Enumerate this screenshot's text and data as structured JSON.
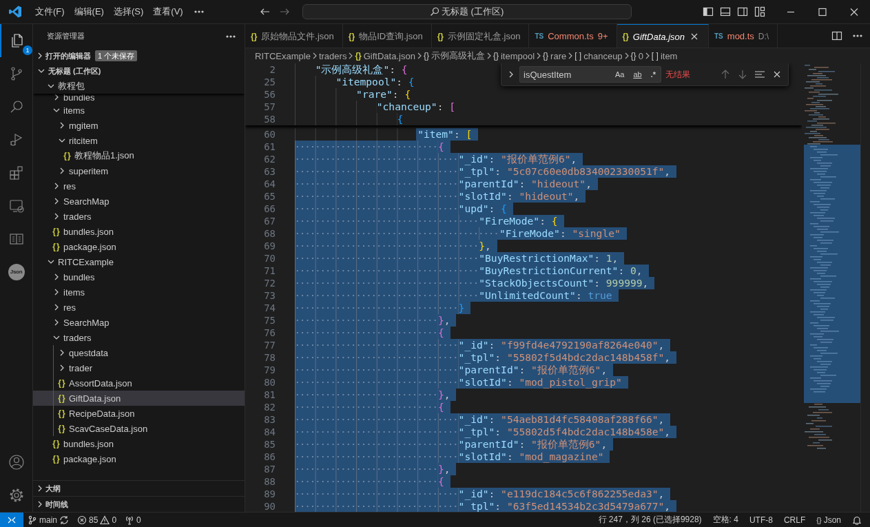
{
  "title_bar": {
    "menus": [
      {
        "label": "文件(F)"
      },
      {
        "label": "编辑(E)"
      },
      {
        "label": "选择(S)"
      },
      {
        "label": "查看(V)"
      }
    ],
    "command_center": "无标题 (工作区)"
  },
  "activity_bar": {
    "top": [
      {
        "kind": "explorer",
        "selected": true,
        "badge": "1"
      },
      {
        "kind": "scm",
        "selected": false
      },
      {
        "kind": "search",
        "selected": false
      },
      {
        "kind": "debug",
        "selected": false
      },
      {
        "kind": "extensions",
        "selected": false
      },
      {
        "kind": "remote",
        "selected": false
      },
      {
        "kind": "book",
        "selected": false
      },
      {
        "kind": "json",
        "selected": false,
        "label": "Json"
      }
    ],
    "bottom": [
      {
        "kind": "account",
        "selected": false
      },
      {
        "kind": "settings",
        "selected": false
      }
    ]
  },
  "sidebar": {
    "title": "资源管理器",
    "open_editors": {
      "label": "打开的编辑器",
      "expanded": false,
      "badge": "1 个未保存"
    },
    "tree": {
      "kind": "root",
      "label": "无标题 (工作区)",
      "expanded": true,
      "selected": false,
      "children": [
        {
          "kind": "folder",
          "label": "教程包",
          "expanded": true,
          "selected": false,
          "children": [
            {
              "kind": "folder",
              "label": "bundles",
              "expanded": false,
              "selected": false
            },
            {
              "kind": "folder",
              "label": "items",
              "expanded": true,
              "selected": false,
              "children": [
                {
                  "kind": "folder",
                  "label": "mgitem",
                  "expanded": false,
                  "selected": false
                },
                {
                  "kind": "folder",
                  "label": "ritcitem",
                  "expanded": true,
                  "selected": false,
                  "children": [
                    {
                      "kind": "file",
                      "icon": "{}",
                      "label": "教程物品1.json",
                      "selected": false
                    }
                  ]
                },
                {
                  "kind": "folder",
                  "label": "superitem",
                  "expanded": false,
                  "selected": false
                }
              ]
            },
            {
              "kind": "folder",
              "label": "res",
              "expanded": false,
              "selected": false
            },
            {
              "kind": "folder",
              "label": "SearchMap",
              "expanded": false,
              "selected": false
            },
            {
              "kind": "folder",
              "label": "traders",
              "expanded": false,
              "selected": false
            },
            {
              "kind": "file",
              "icon": "{}",
              "label": "bundles.json",
              "selected": false
            },
            {
              "kind": "file",
              "icon": "{}",
              "label": "package.json",
              "selected": false
            }
          ]
        },
        {
          "kind": "folder",
          "label": "RITCExample",
          "expanded": true,
          "selected": false,
          "children": [
            {
              "kind": "folder",
              "label": "bundles",
              "expanded": false,
              "selected": false
            },
            {
              "kind": "folder",
              "label": "items",
              "expanded": false,
              "selected": false
            },
            {
              "kind": "folder",
              "label": "res",
              "expanded": false,
              "selected": false
            },
            {
              "kind": "folder",
              "label": "SearchMap",
              "expanded": false,
              "selected": false
            },
            {
              "kind": "folder",
              "label": "traders",
              "expanded": true,
              "selected": false,
              "children": [
                {
                  "kind": "folder",
                  "label": "questdata",
                  "expanded": false,
                  "selected": false
                },
                {
                  "kind": "folder",
                  "label": "trader",
                  "expanded": false,
                  "selected": false
                },
                {
                  "kind": "file",
                  "icon": "{}",
                  "label": "AssortData.json",
                  "selected": false
                },
                {
                  "kind": "file",
                  "icon": "{}",
                  "label": "GiftData.json",
                  "selected": true
                },
                {
                  "kind": "file",
                  "icon": "{}",
                  "label": "RecipeData.json",
                  "selected": false
                },
                {
                  "kind": "file",
                  "icon": "{}",
                  "label": "ScavCaseData.json",
                  "selected": false
                }
              ]
            },
            {
              "kind": "file",
              "icon": "{}",
              "label": "bundles.json",
              "selected": false
            },
            {
              "kind": "file",
              "icon": "{}",
              "label": "package.json",
              "selected": false
            }
          ]
        }
      ]
    },
    "sections": [
      {
        "label": "大纲",
        "expanded": false
      },
      {
        "label": "时间线",
        "expanded": false
      }
    ]
  },
  "tabs": [
    {
      "kind": "json",
      "icon": "{}",
      "label": "原始物品文件.json",
      "selected": false,
      "preview": false,
      "problem": false
    },
    {
      "kind": "json",
      "icon": "{}",
      "label": "物品ID查询.json",
      "selected": false,
      "preview": false,
      "problem": false
    },
    {
      "kind": "json",
      "icon": "{}",
      "label": "示例固定礼盒.json",
      "selected": false,
      "preview": false,
      "problem": false
    },
    {
      "kind": "ts",
      "icon": "TS",
      "label": "Common.ts",
      "badge": "9+",
      "selected": false,
      "preview": false,
      "problem": true
    },
    {
      "kind": "json",
      "icon": "{}",
      "label": "GiftData.json",
      "selected": true,
      "preview": true,
      "problem": false
    },
    {
      "kind": "ts",
      "icon": "TS",
      "label": "mod.ts",
      "description": "D:\\",
      "selected": false,
      "preview": false,
      "problem": true
    }
  ],
  "breadcrumbs": [
    {
      "kind": "folder",
      "label": "RITCExample"
    },
    {
      "kind": "folder",
      "label": "traders"
    },
    {
      "kind": "file",
      "icon": "{}",
      "label": "GiftData.json"
    },
    {
      "kind": "symbol",
      "icon": "{}",
      "label": "示例高级礼盒"
    },
    {
      "kind": "symbol",
      "icon": "{}",
      "label": "itempool"
    },
    {
      "kind": "symbol",
      "icon": "{}",
      "label": "rare"
    },
    {
      "kind": "symbol",
      "icon": "[ ]",
      "label": "chanceup"
    },
    {
      "kind": "symbol",
      "icon": "{}",
      "label": "0"
    },
    {
      "kind": "symbol",
      "icon": "[ ]",
      "label": "item"
    }
  ],
  "find": {
    "value": "isQuestItem",
    "options": [
      {
        "kind": "case",
        "label": "Aa",
        "on": false
      },
      {
        "kind": "word",
        "label": "ab",
        "on": false
      },
      {
        "kind": "regex",
        "label": ".*",
        "on": false
      }
    ],
    "result": "无结果"
  },
  "sticky_lines": [
    {
      "num": "2",
      "tokens": [
        {
          "kind": "key",
          "text": "\"示例高级礼盒\""
        },
        {
          "kind": "punc",
          "text": ": "
        },
        {
          "kind": "bracket",
          "text": "{",
          "color": "#da70d6"
        }
      ]
    },
    {
      "num": "25",
      "tokens": [
        {
          "kind": "key",
          "text": "\"itempool\""
        },
        {
          "kind": "punc",
          "text": ": "
        },
        {
          "kind": "bracket",
          "text": "{",
          "color": "#179fff"
        }
      ]
    },
    {
      "num": "56",
      "tokens": [
        {
          "kind": "key",
          "text": "\"rare\""
        },
        {
          "kind": "punc",
          "text": ": "
        },
        {
          "kind": "bracket",
          "text": "{",
          "color": "#ffd700"
        }
      ]
    },
    {
      "num": "57",
      "tokens": [
        {
          "kind": "key",
          "text": "\"chanceup\""
        },
        {
          "kind": "punc",
          "text": ": "
        },
        {
          "kind": "bracket",
          "text": "[",
          "color": "#da70d6"
        }
      ]
    },
    {
      "num": "58",
      "tokens": [
        {
          "kind": "bracket",
          "text": "{",
          "color": "#179fff"
        }
      ]
    }
  ],
  "lines": [
    {
      "num": "60",
      "selected": true,
      "indent_selected": false,
      "tokens": [
        {
          "kind": "key",
          "text": "\"item\""
        },
        {
          "kind": "punc",
          "text": ": "
        },
        {
          "kind": "bracket",
          "text": "[",
          "color": "#ffd700"
        }
      ]
    },
    {
      "num": "61",
      "selected": true,
      "indent_selected": true,
      "tokens": [
        {
          "kind": "bracket",
          "text": "{",
          "color": "#da70d6"
        }
      ]
    },
    {
      "num": "62",
      "selected": true,
      "indent_selected": true,
      "tokens": [
        {
          "kind": "key",
          "text": "\"_id\""
        },
        {
          "kind": "punc",
          "text": ": "
        },
        {
          "kind": "str",
          "text": "\"报价单范例6\""
        },
        {
          "kind": "punc",
          "text": ","
        }
      ]
    },
    {
      "num": "63",
      "selected": true,
      "indent_selected": true,
      "tokens": [
        {
          "kind": "key",
          "text": "\"_tpl\""
        },
        {
          "kind": "punc",
          "text": ": "
        },
        {
          "kind": "str",
          "text": "\"5c07c60e0db834002330051f\""
        },
        {
          "kind": "punc",
          "text": ","
        }
      ]
    },
    {
      "num": "64",
      "selected": true,
      "indent_selected": true,
      "tokens": [
        {
          "kind": "key",
          "text": "\"parentId\""
        },
        {
          "kind": "punc",
          "text": ": "
        },
        {
          "kind": "str",
          "text": "\"hideout\""
        },
        {
          "kind": "punc",
          "text": ","
        }
      ]
    },
    {
      "num": "65",
      "selected": true,
      "indent_selected": true,
      "tokens": [
        {
          "kind": "key",
          "text": "\"slotId\""
        },
        {
          "kind": "punc",
          "text": ": "
        },
        {
          "kind": "str",
          "text": "\"hideout\""
        },
        {
          "kind": "punc",
          "text": ","
        }
      ]
    },
    {
      "num": "66",
      "selected": true,
      "indent_selected": true,
      "tokens": [
        {
          "kind": "key",
          "text": "\"upd\""
        },
        {
          "kind": "punc",
          "text": ": "
        },
        {
          "kind": "bracket",
          "text": "{",
          "color": "#179fff"
        }
      ]
    },
    {
      "num": "67",
      "selected": true,
      "indent_selected": true,
      "tokens": [
        {
          "kind": "key",
          "text": "\"FireMode\""
        },
        {
          "kind": "punc",
          "text": ": "
        },
        {
          "kind": "bracket",
          "text": "{",
          "color": "#ffd700"
        }
      ]
    },
    {
      "num": "68",
      "selected": true,
      "indent_selected": true,
      "tokens": [
        {
          "kind": "key",
          "text": "\"FireMode\""
        },
        {
          "kind": "punc",
          "text": ": "
        },
        {
          "kind": "str",
          "text": "\"single\""
        }
      ]
    },
    {
      "num": "69",
      "selected": true,
      "indent_selected": true,
      "tokens": [
        {
          "kind": "bracket",
          "text": "}",
          "color": "#ffd700"
        },
        {
          "kind": "punc",
          "text": ","
        }
      ]
    },
    {
      "num": "70",
      "selected": true,
      "indent_selected": true,
      "tokens": [
        {
          "kind": "key",
          "text": "\"BuyRestrictionMax\""
        },
        {
          "kind": "punc",
          "text": ": "
        },
        {
          "kind": "num",
          "text": "1"
        },
        {
          "kind": "punc",
          "text": ","
        }
      ]
    },
    {
      "num": "71",
      "selected": true,
      "indent_selected": true,
      "tokens": [
        {
          "kind": "key",
          "text": "\"BuyRestrictionCurrent\""
        },
        {
          "kind": "punc",
          "text": ": "
        },
        {
          "kind": "num",
          "text": "0"
        },
        {
          "kind": "punc",
          "text": ","
        }
      ]
    },
    {
      "num": "72",
      "selected": true,
      "indent_selected": true,
      "tokens": [
        {
          "kind": "key",
          "text": "\"StackObjectsCount\""
        },
        {
          "kind": "punc",
          "text": ": "
        },
        {
          "kind": "num",
          "text": "999999"
        },
        {
          "kind": "punc",
          "text": ","
        }
      ]
    },
    {
      "num": "73",
      "selected": true,
      "indent_selected": true,
      "tokens": [
        {
          "kind": "key",
          "text": "\"UnlimitedCount\""
        },
        {
          "kind": "punc",
          "text": ": "
        },
        {
          "kind": "bool",
          "text": "true"
        }
      ]
    },
    {
      "num": "74",
      "selected": true,
      "indent_selected": true,
      "tokens": [
        {
          "kind": "bracket",
          "text": "}",
          "color": "#179fff"
        }
      ]
    },
    {
      "num": "75",
      "selected": true,
      "indent_selected": true,
      "tokens": [
        {
          "kind": "bracket",
          "text": "}",
          "color": "#da70d6"
        },
        {
          "kind": "punc",
          "text": ","
        }
      ]
    },
    {
      "num": "76",
      "selected": true,
      "indent_selected": true,
      "tokens": [
        {
          "kind": "bracket",
          "text": "{",
          "color": "#da70d6"
        }
      ]
    },
    {
      "num": "77",
      "selected": true,
      "indent_selected": true,
      "tokens": [
        {
          "kind": "key",
          "text": "\"_id\""
        },
        {
          "kind": "punc",
          "text": ": "
        },
        {
          "kind": "str",
          "text": "\"f99fd4e4792190af8264e040\""
        },
        {
          "kind": "punc",
          "text": ","
        }
      ]
    },
    {
      "num": "78",
      "selected": true,
      "indent_selected": true,
      "tokens": [
        {
          "kind": "key",
          "text": "\"_tpl\""
        },
        {
          "kind": "punc",
          "text": ": "
        },
        {
          "kind": "str",
          "text": "\"55802f5d4bdc2dac148b458f\""
        },
        {
          "kind": "punc",
          "text": ","
        }
      ]
    },
    {
      "num": "79",
      "selected": true,
      "indent_selected": true,
      "tokens": [
        {
          "kind": "key",
          "text": "\"parentId\""
        },
        {
          "kind": "punc",
          "text": ": "
        },
        {
          "kind": "str",
          "text": "\"报价单范例6\""
        },
        {
          "kind": "punc",
          "text": ","
        }
      ]
    },
    {
      "num": "80",
      "selected": true,
      "indent_selected": true,
      "tokens": [
        {
          "kind": "key",
          "text": "\"slotId\""
        },
        {
          "kind": "punc",
          "text": ": "
        },
        {
          "kind": "str",
          "text": "\"mod_pistol_grip\""
        }
      ]
    },
    {
      "num": "81",
      "selected": true,
      "indent_selected": true,
      "tokens": [
        {
          "kind": "bracket",
          "text": "}",
          "color": "#da70d6"
        },
        {
          "kind": "punc",
          "text": ","
        }
      ]
    },
    {
      "num": "82",
      "selected": true,
      "indent_selected": true,
      "tokens": [
        {
          "kind": "bracket",
          "text": "{",
          "color": "#da70d6"
        }
      ]
    },
    {
      "num": "83",
      "selected": true,
      "indent_selected": true,
      "tokens": [
        {
          "kind": "key",
          "text": "\"_id\""
        },
        {
          "kind": "punc",
          "text": ": "
        },
        {
          "kind": "str",
          "text": "\"54aeb81d4fc58408af288f66\""
        },
        {
          "kind": "punc",
          "text": ","
        }
      ]
    },
    {
      "num": "84",
      "selected": true,
      "indent_selected": true,
      "tokens": [
        {
          "kind": "key",
          "text": "\"_tpl\""
        },
        {
          "kind": "punc",
          "text": ": "
        },
        {
          "kind": "str",
          "text": "\"55802d5f4bdc2dac148b458e\""
        },
        {
          "kind": "punc",
          "text": ","
        }
      ]
    },
    {
      "num": "85",
      "selected": true,
      "indent_selected": true,
      "tokens": [
        {
          "kind": "key",
          "text": "\"parentId\""
        },
        {
          "kind": "punc",
          "text": ": "
        },
        {
          "kind": "str",
          "text": "\"报价单范例6\""
        },
        {
          "kind": "punc",
          "text": ","
        }
      ]
    },
    {
      "num": "86",
      "selected": true,
      "indent_selected": true,
      "tokens": [
        {
          "kind": "key",
          "text": "\"slotId\""
        },
        {
          "kind": "punc",
          "text": ": "
        },
        {
          "kind": "str",
          "text": "\"mod_magazine\""
        }
      ]
    },
    {
      "num": "87",
      "selected": true,
      "indent_selected": true,
      "tokens": [
        {
          "kind": "bracket",
          "text": "}",
          "color": "#da70d6"
        },
        {
          "kind": "punc",
          "text": ","
        }
      ]
    },
    {
      "num": "88",
      "selected": true,
      "indent_selected": true,
      "tokens": [
        {
          "kind": "bracket",
          "text": "{",
          "color": "#da70d6"
        }
      ]
    },
    {
      "num": "89",
      "selected": true,
      "indent_selected": true,
      "tokens": [
        {
          "kind": "key",
          "text": "\"_id\""
        },
        {
          "kind": "punc",
          "text": ": "
        },
        {
          "kind": "str",
          "text": "\"e119dc184c5c6f862255eda3\""
        },
        {
          "kind": "punc",
          "text": ","
        }
      ]
    },
    {
      "num": "90",
      "selected": true,
      "indent_selected": true,
      "tokens": [
        {
          "kind": "key",
          "text": "\"_tpl\""
        },
        {
          "kind": "punc",
          "text": ": "
        },
        {
          "kind": "str",
          "text": "\"63f5ed14534b2c3d5479a677\""
        },
        {
          "kind": "punc",
          "text": ","
        }
      ]
    }
  ],
  "status_bar": {
    "branch": "main",
    "errors": "85",
    "warnings": "0",
    "ports": "0",
    "position": "行 247，列 26 (已选择9928)",
    "indentation": "空格: 4",
    "encoding": "UTF-8",
    "eol": "CRLF",
    "language_icon": "{}",
    "language": "Json"
  }
}
